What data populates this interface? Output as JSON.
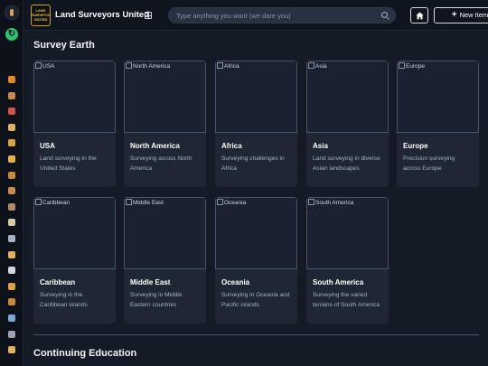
{
  "app": {
    "title": "Land Surveyors United",
    "logo_text": "LAND SURVEYORS UNITED"
  },
  "search": {
    "placeholder": "Type anything you want (we dare you)"
  },
  "toolbar": {
    "new_item_label": "New Item"
  },
  "sections": {
    "survey_earth": "Survey Earth",
    "continuing_education": "Continuing Education"
  },
  "cards": [
    {
      "alt": "USA",
      "name": "USA",
      "desc": "Land surveying in the United States"
    },
    {
      "alt": "North America",
      "name": "North America",
      "desc": "Surveying across North America"
    },
    {
      "alt": "Africa",
      "name": "Africa",
      "desc": "Surveying challenges in Africa"
    },
    {
      "alt": "Asia",
      "name": "Asia",
      "desc": "Land surveying in diverse Asian landscapes"
    },
    {
      "alt": "Europe",
      "name": "Europe",
      "desc": "Precision surveying across Europe"
    },
    {
      "alt": "Caribbean",
      "name": "Caribbean",
      "desc": "Surveying in the Caribbean islands"
    },
    {
      "alt": "Middle East",
      "name": "Middle East",
      "desc": "Surveying in Middle Eastern countries"
    },
    {
      "alt": "Oceania",
      "name": "Oceania",
      "desc": "Surveying in Oceania and Pacific islands"
    },
    {
      "alt": "South America",
      "name": "South America",
      "desc": "Surveying the varied terrains of South America"
    }
  ],
  "sidebar_icons": [
    {
      "name": "plus-icon",
      "color": "#e08a2c"
    },
    {
      "name": "burger-icon",
      "color": "#c98b4b"
    },
    {
      "name": "tools-icon",
      "color": "#d2534b"
    },
    {
      "name": "person-icon",
      "color": "#e0b25a"
    },
    {
      "name": "box-icon",
      "color": "#d9a441"
    },
    {
      "name": "folder-icon",
      "color": "#e6b347"
    },
    {
      "name": "package-icon",
      "color": "#c98a3d"
    },
    {
      "name": "globe-icon",
      "color": "#c98b4b"
    },
    {
      "name": "group-icon",
      "color": "#b08a6a"
    },
    {
      "name": "scroll-icon",
      "color": "#d8c8a8"
    },
    {
      "name": "vial-icon",
      "color": "#a6b4c4"
    },
    {
      "name": "user-icon",
      "color": "#e0b25a"
    },
    {
      "name": "tag-icon",
      "color": "#cfd6e0"
    },
    {
      "name": "calendar-icon",
      "color": "#e0a23c"
    },
    {
      "name": "grid-icon",
      "color": "#c98a3d"
    },
    {
      "name": "building-icon",
      "color": "#7ea6d8"
    },
    {
      "name": "settings-icon",
      "color": "#9aa3b2"
    },
    {
      "name": "profile-icon",
      "color": "#e0b25a"
    }
  ]
}
